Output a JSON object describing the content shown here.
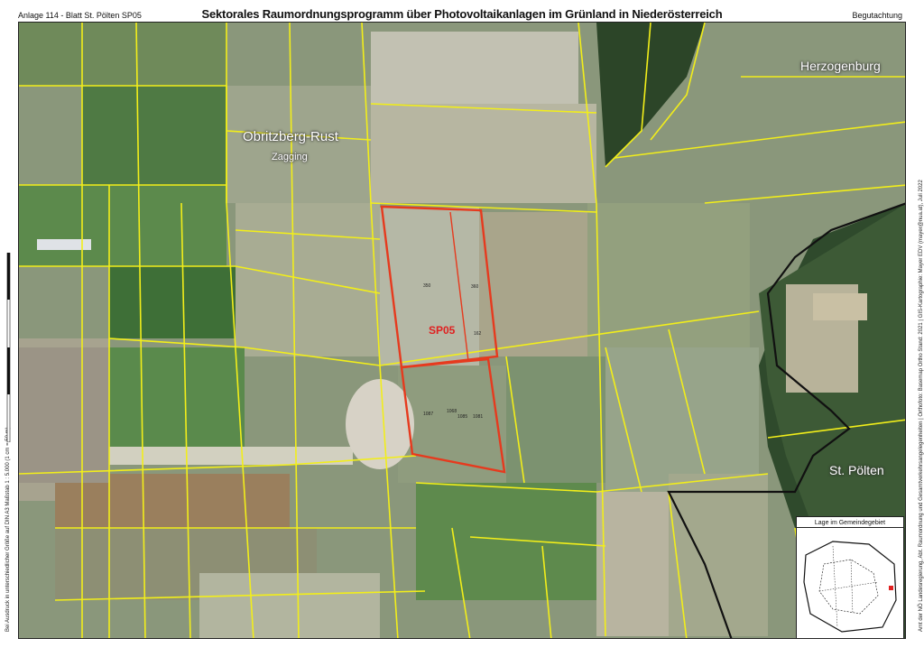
{
  "header": {
    "left": "Anlage 114 - Blatt St. Pölten SP05",
    "title": "Sektorales Raumordnungsprogramm über Photovoltaikanlagen im Grünland in Niederösterreich",
    "right": "Begutachtung"
  },
  "map": {
    "places": {
      "herzogenburg": "Herzogenburg",
      "obritzberg": "Obritzberg-Rust",
      "zagging": "Zagging",
      "stpoelten": "St. Pölten"
    },
    "zone_label": "SP05",
    "parcel_numbers": [
      "350",
      "360",
      "162",
      "1087",
      "1068",
      "1085",
      "1081"
    ],
    "colors": {
      "parcel_lines": "#f2ee1a",
      "zone_outline": "#e63a1e",
      "municipal_border": "#111111",
      "field_dark": "#3f6b3a",
      "field_light": "#b9c2a6"
    }
  },
  "side_left": {
    "text": "Bei Ausdruck in unterschiedlicher Größe auf DIN A3 Maßstab 1 : 5.000 (1 cm = 50 m)",
    "scale_title": "Legende Stand: Anlage 2",
    "scale_ticks": [
      "0",
      "100",
      "200",
      "300 Meter"
    ]
  },
  "side_right": {
    "text": "Amt der NÖ Landesregierung, Abt. Raumordnung und Gesamtverkehrsangelegenheiten | Orthofoto: Basemap Ortho Stand: 2021 | GIS-Kartographie: Mayer EDV (mayer@nua.at), Juli 2022"
  },
  "inset": {
    "title": "Lage im Gemeindegebiet"
  }
}
